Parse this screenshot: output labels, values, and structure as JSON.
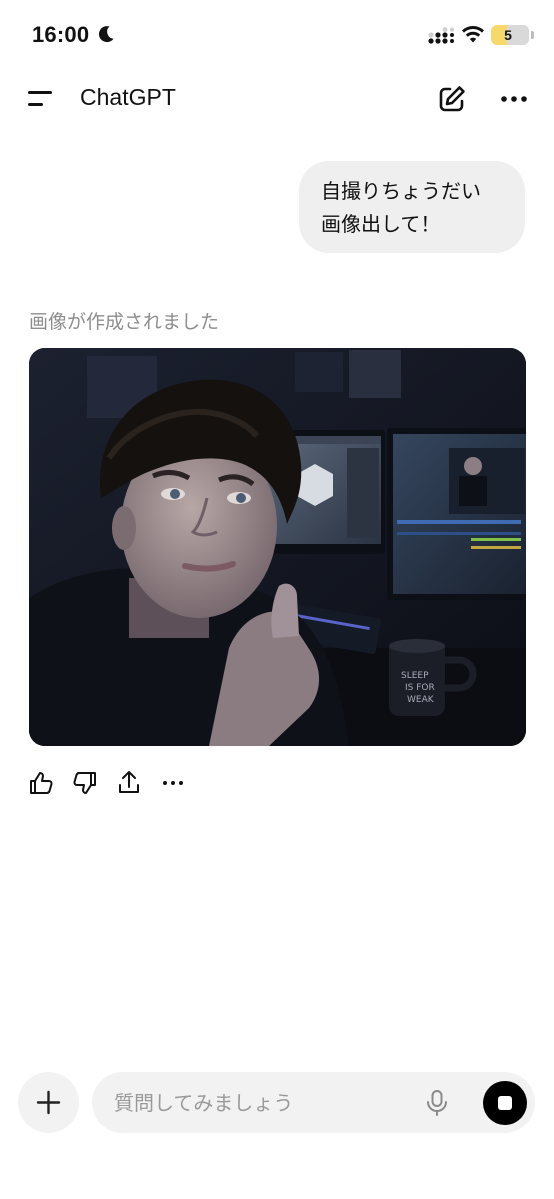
{
  "status_bar": {
    "time": "16:00",
    "battery": "5",
    "icons": [
      "moon-icon",
      "cellular-signal-icon",
      "wifi-icon",
      "battery-icon"
    ]
  },
  "header": {
    "title": "ChatGPT",
    "icons": [
      "menu-icon",
      "new-chat-icon",
      "more-icon"
    ]
  },
  "conversation": {
    "user_message": {
      "lines": [
        "自撮りちょうだい",
        "画像出して！"
      ]
    },
    "assistant": {
      "status_label": "画像が作成されました",
      "image": "selfie-photo",
      "actions": [
        "thumbs-up-icon",
        "thumbs-down-icon",
        "share-icon",
        "more-icon"
      ]
    }
  },
  "composer": {
    "placeholder": "質問してみましょう",
    "value": "",
    "icons": [
      "plus-icon",
      "mic-icon",
      "voice-mode-icon"
    ]
  },
  "colors": {
    "bubble": "#efefef",
    "input_background": "#f2f2f2",
    "muted_text": "#8e8e8e",
    "battery_fill": "#f6d86c"
  }
}
